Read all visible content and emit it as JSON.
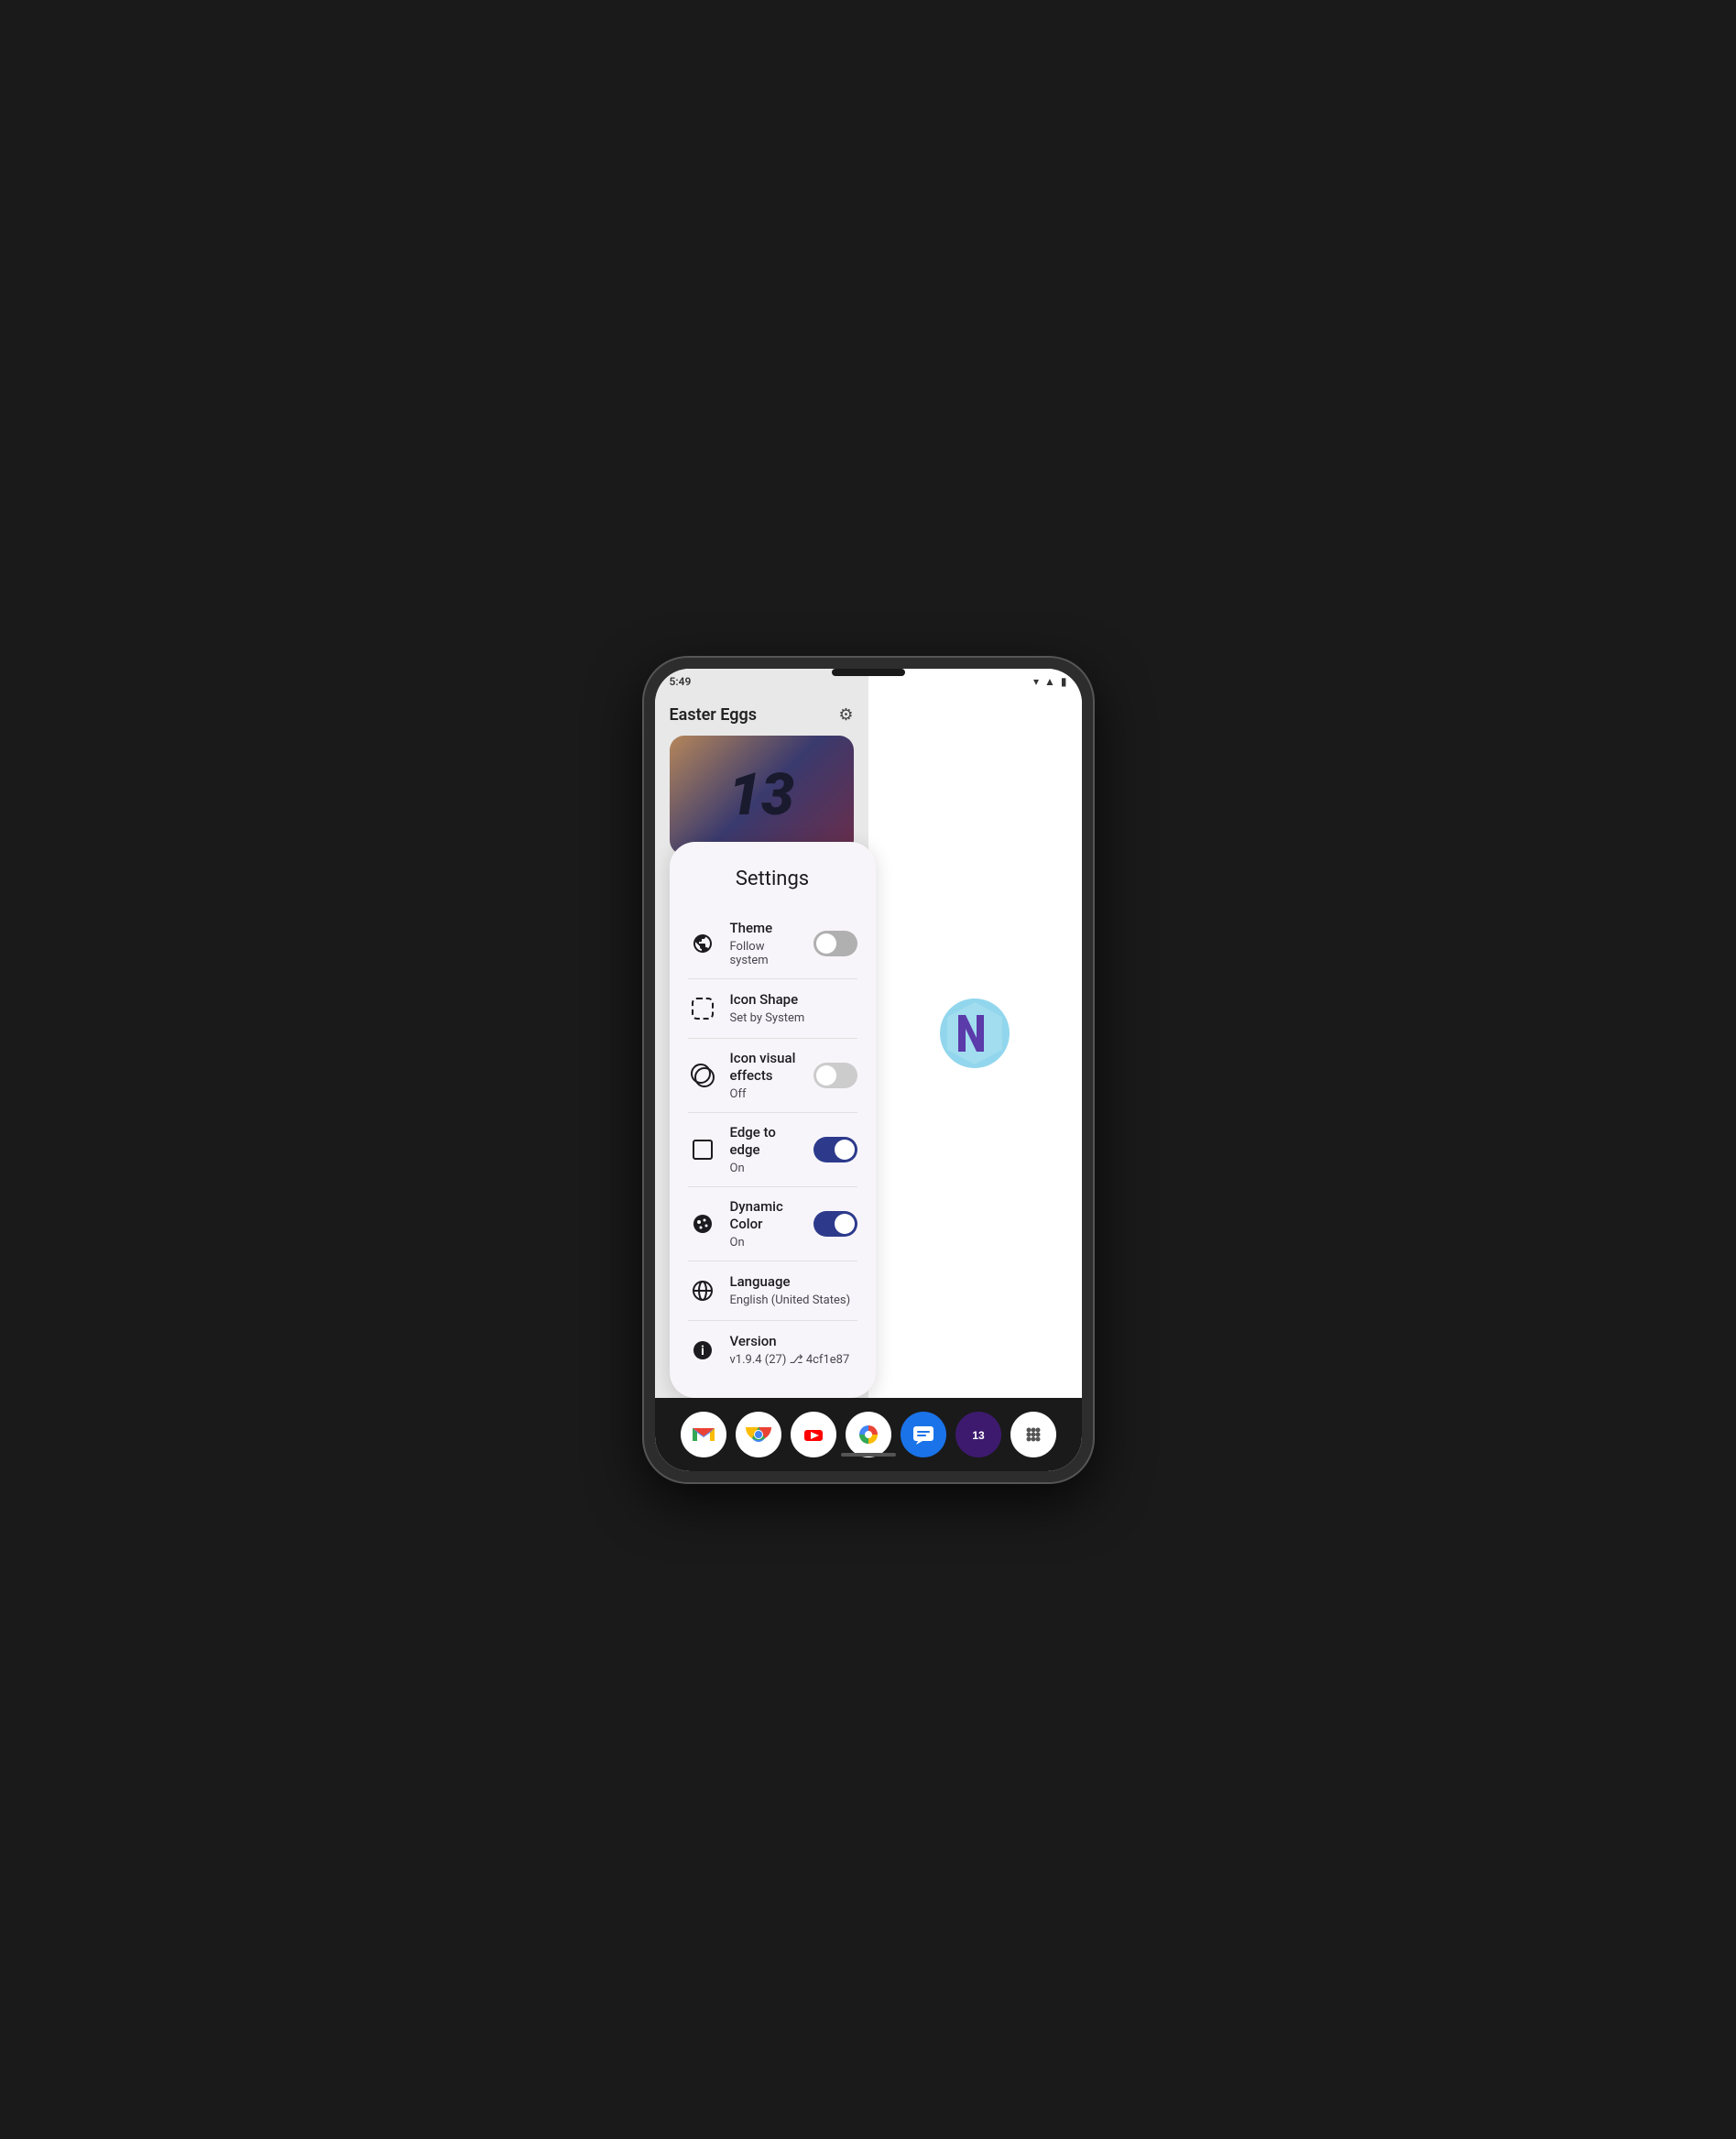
{
  "phone": {
    "time": "5:49",
    "status_icons": [
      "wifi",
      "signal",
      "battery"
    ]
  },
  "background_app": {
    "title": "Easter Eggs",
    "gear_icon": "⚙",
    "egg_number": "13"
  },
  "settings": {
    "title": "Settings",
    "items": [
      {
        "id": "theme",
        "label": "Theme",
        "value": "Follow system",
        "has_toggle": true,
        "toggle_state": "off"
      },
      {
        "id": "icon_shape",
        "label": "Icon Shape",
        "value": "Set by System",
        "has_toggle": false
      },
      {
        "id": "icon_visual_effects",
        "label": "Icon visual effects",
        "value": "Off",
        "has_toggle": true,
        "toggle_state": "off"
      },
      {
        "id": "edge_to_edge",
        "label": "Edge to edge",
        "value": "On",
        "has_toggle": true,
        "toggle_state": "on"
      },
      {
        "id": "dynamic_color",
        "label": "Dynamic Color",
        "value": "On",
        "has_toggle": true,
        "toggle_state": "on"
      },
      {
        "id": "language",
        "label": "Language",
        "value": "English (United States)",
        "has_toggle": false
      },
      {
        "id": "version",
        "label": "Version",
        "value": "v1.9.4 (27) ⎇ 4cf1e87",
        "has_toggle": false
      }
    ]
  },
  "nav_bar": {
    "apps": [
      {
        "name": "Gmail",
        "icon": "M",
        "bg": "#ffffff",
        "color": "#EA4335"
      },
      {
        "name": "Chrome",
        "icon": "⊕",
        "bg": "#ffffff",
        "color": "#4285F4"
      },
      {
        "name": "YouTube",
        "icon": "▶",
        "bg": "#ffffff",
        "color": "#FF0000"
      },
      {
        "name": "Photos",
        "icon": "✿",
        "bg": "#ffffff",
        "color": "#FBBC05"
      },
      {
        "name": "Messages",
        "icon": "✉",
        "bg": "#1a73e8",
        "color": "#ffffff"
      },
      {
        "name": "Android13",
        "icon": "13",
        "bg": "#3d1a6e",
        "color": "#ffffff"
      },
      {
        "name": "Apps",
        "icon": "⋯",
        "bg": "#ffffff",
        "color": "#333"
      }
    ]
  }
}
